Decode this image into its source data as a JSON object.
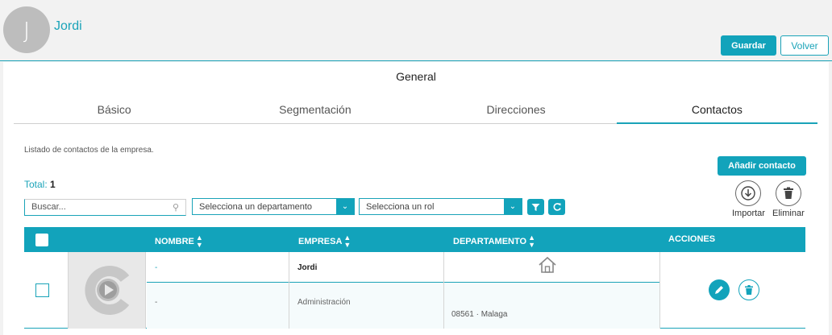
{
  "header": {
    "avatar_initial": "J",
    "username": "Jordi",
    "save_label": "Guardar",
    "back_label": "Volver"
  },
  "section": {
    "title": "General"
  },
  "tabs": [
    {
      "label": "Básico"
    },
    {
      "label": "Segmentación"
    },
    {
      "label": "Direcciones"
    },
    {
      "label": "Contactos"
    }
  ],
  "contacts": {
    "description": "Listado de contactos de la empresa.",
    "total_label": "Total:",
    "total_value": "1",
    "add_label": "Añadir contacto",
    "import_label": "Importar",
    "delete_label": "Eliminar",
    "search_placeholder": "Buscar...",
    "department_select": "Selecciona un departamento",
    "role_select": "Selecciona un rol"
  },
  "table": {
    "columns": [
      "NOMBRE",
      "EMPRESA",
      "DEPARTAMENTO",
      "ACCIONES"
    ],
    "rows": [
      {
        "nombre": "-",
        "nombre_sub": "-",
        "empresa": "Jordi",
        "empresa_sub": "Administración",
        "departamento_sub": "08561 · Malaga"
      }
    ]
  },
  "colors": {
    "accent": "#12a3bb",
    "text": "#333333"
  },
  "icons": [
    "search-icon",
    "chevron-down-icon",
    "filter-icon",
    "refresh-icon",
    "import-icon",
    "trash-icon",
    "home-icon",
    "play-icon",
    "edit-icon"
  ]
}
